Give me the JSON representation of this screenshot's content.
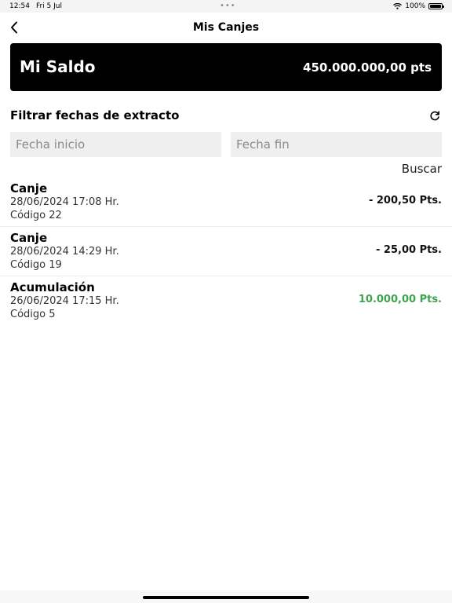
{
  "status_bar": {
    "time": "12:54",
    "date": "Fri 5 Jul",
    "battery": "100%"
  },
  "nav": {
    "title": "Mis Canjes"
  },
  "balance": {
    "label": "Mi Saldo",
    "value": "450.000.000,00 pts"
  },
  "filter": {
    "title": "Filtrar fechas de extracto",
    "start_placeholder": "Fecha inicio",
    "end_placeholder": "Fecha fin",
    "search_label": "Buscar"
  },
  "transactions": [
    {
      "type": "Canje",
      "date": "28/06/2024 17:08 Hr.",
      "code": "Código 22",
      "amount": "- 200,50 Pts.",
      "sign": "negative"
    },
    {
      "type": "Canje",
      "date": "28/06/2024 14:29 Hr.",
      "code": "Código 19",
      "amount": "- 25,00 Pts.",
      "sign": "negative"
    },
    {
      "type": "Acumulación",
      "date": "26/06/2024 17:15 Hr.",
      "code": "Código 5",
      "amount": "10.000,00 Pts.",
      "sign": "positive"
    }
  ],
  "colors": {
    "positive": "#3fa34d",
    "card_bg": "#000000",
    "input_bg": "#efefef"
  }
}
